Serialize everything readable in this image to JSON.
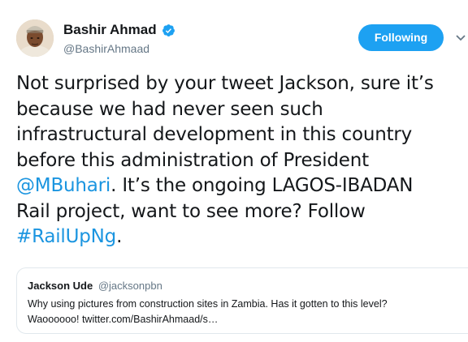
{
  "author": {
    "display_name": "Bashir Ahmad",
    "handle": "@BashirAhmaad",
    "verified": true,
    "avatar_icon": "user-avatar-photo"
  },
  "follow_button": {
    "label": "Following"
  },
  "menu": {
    "icon": "chevron-down-icon"
  },
  "tweet": {
    "text_part1": "Not surprised by your tweet Jackson, sure it’s\nbecause we had never seen such\ninfrastructural development in this country\nbefore this administration of President\n",
    "mention": "@MBuhari",
    "text_part2": ". It’s the ongoing LAGOS-IBADAN\nRail project, want to see more? Follow\n",
    "hashtag": "#RailUpNg",
    "text_part3": "."
  },
  "quote": {
    "name": "Jackson Ude",
    "handle": "@jacksonpbn",
    "text": "Why using pictures from construction sites in Zambia. Has it gotten to this level?\nWaoooooo! twitter.com/BashirAhmaad/s…"
  },
  "colors": {
    "accent": "#1da1f2",
    "link": "#1b95e0",
    "text": "#14171a",
    "muted": "#657786",
    "border": "#e1e8ed"
  }
}
